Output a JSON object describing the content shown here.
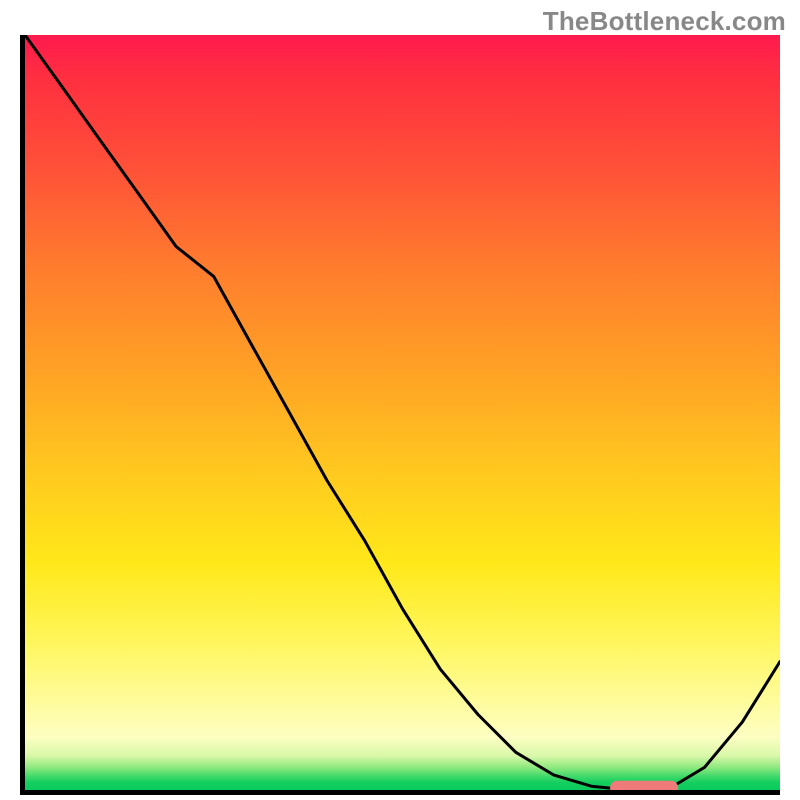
{
  "watermark": "TheBottleneck.com",
  "chart_data": {
    "type": "line",
    "x": [
      0.0,
      0.05,
      0.1,
      0.15,
      0.2,
      0.25,
      0.3,
      0.35,
      0.4,
      0.45,
      0.5,
      0.55,
      0.6,
      0.65,
      0.7,
      0.75,
      0.8,
      0.85,
      0.9,
      0.95,
      1.0
    ],
    "y": [
      1.0,
      0.93,
      0.86,
      0.79,
      0.72,
      0.68,
      0.59,
      0.5,
      0.41,
      0.33,
      0.24,
      0.16,
      0.1,
      0.05,
      0.02,
      0.005,
      0.0,
      0.0,
      0.03,
      0.09,
      0.17
    ],
    "marker": {
      "x_center": 0.82,
      "x_half_width": 0.045,
      "y": 0.003,
      "color": "#ef7a7a"
    },
    "xlim": [
      0,
      1
    ],
    "ylim": [
      0,
      1
    ],
    "xlabel": "",
    "ylabel": "",
    "title": "",
    "gradient_stops": [
      {
        "pos": 0.0,
        "color": "#ff1a4d"
      },
      {
        "pos": 0.18,
        "color": "#ff5238"
      },
      {
        "pos": 0.45,
        "color": "#ffa325"
      },
      {
        "pos": 0.7,
        "color": "#ffe81a"
      },
      {
        "pos": 0.93,
        "color": "#fdfec2"
      },
      {
        "pos": 0.97,
        "color": "#8ee97f"
      },
      {
        "pos": 1.0,
        "color": "#0acb5c"
      }
    ]
  }
}
